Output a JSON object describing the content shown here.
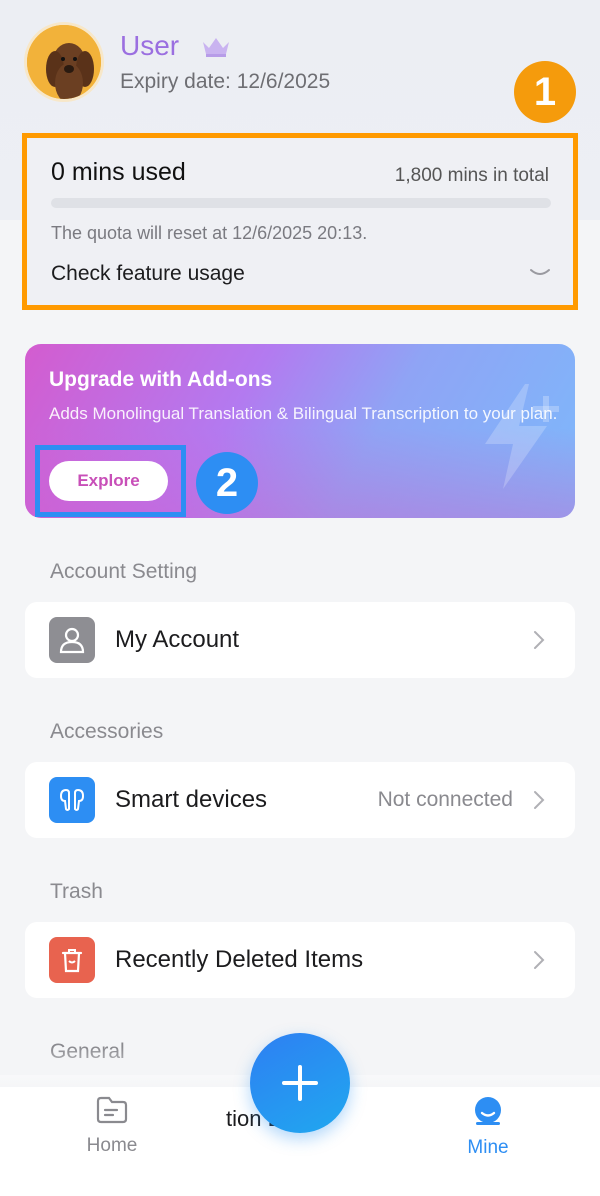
{
  "profile": {
    "username": "User",
    "expiry": "Expiry date: 12/6/2025",
    "avatar_icon": "dog-avatar",
    "crown_icon": "crown-icon"
  },
  "annotations": {
    "badge_1": "1",
    "badge_2": "2"
  },
  "quota": {
    "used_label": "0 mins used",
    "total_label": "1,800 mins in total",
    "used_fraction": 0,
    "reset_text": "The quota will reset at 12/6/2025 20:13.",
    "feature_usage_label": "Check feature usage"
  },
  "upgrade": {
    "title": "Upgrade with Add-ons",
    "description": "Adds Monolingual Translation & Bilingual Transcription to your plan.",
    "button_label": "Explore"
  },
  "sections": {
    "account_setting": "Account Setting",
    "accessories": "Accessories",
    "trash": "Trash",
    "general": "General"
  },
  "items": {
    "my_account": "My Account",
    "smart_devices": "Smart devices",
    "smart_devices_status": "Not connected",
    "recently_deleted": "Recently Deleted Items"
  },
  "bottom_nav": {
    "home": "Home",
    "middle_partial": "tion Log...",
    "mine": "Mine"
  },
  "colors": {
    "accent": "#2d8ef3",
    "highlight_orange": "#ff9a00",
    "username_purple": "#9b6fe0",
    "trash_icon_bg": "#e8634f"
  }
}
